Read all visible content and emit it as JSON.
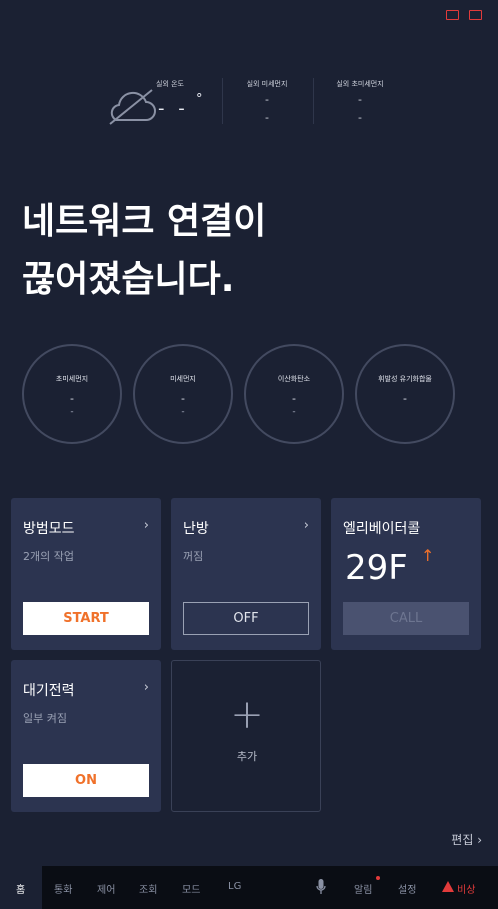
{
  "top": {
    "icons": [
      "screen-icon",
      "monitor-icon"
    ]
  },
  "weather": {
    "temp_label": "실외 온도",
    "temp_value": "- -",
    "temp_unit": "°",
    "dust_label": "실외 미세먼지",
    "dust_value1": "-",
    "dust_value2": "-",
    "fine_label": "실외 초미세먼지",
    "fine_value1": "-",
    "fine_value2": "-"
  },
  "headline": "네트워크 연결이\n끊어졌습니다.",
  "circles": [
    {
      "label": "초미세먼지",
      "v1": "-",
      "v2": "-"
    },
    {
      "label": "미세먼지",
      "v1": "-",
      "v2": "-"
    },
    {
      "label": "이산화탄소",
      "v1": "-",
      "v2": "-"
    },
    {
      "label": "휘발성 유기화합물",
      "v1": "-",
      "v2": ""
    }
  ],
  "cards": {
    "security": {
      "title": "방범모드",
      "chevron": "›",
      "sub": "2개의 작업",
      "button": "START"
    },
    "heating": {
      "title": "난방",
      "chevron": "›",
      "sub": "꺼짐",
      "button": "OFF"
    },
    "elevator": {
      "title": "엘리베이터콜",
      "floor": "29F",
      "arrow": "↑",
      "button": "CALL",
      "accent": "#f0712a"
    },
    "standby": {
      "title": "대기전력",
      "chevron": "›",
      "sub": "일부 켜짐",
      "button": "ON"
    },
    "add": {
      "label": "추가",
      "plus": "+"
    }
  },
  "edit": "편집 ›",
  "nav": {
    "home": "홈",
    "call": "통화",
    "control": "제어",
    "view": "조회",
    "mode": "모드",
    "lg": "LG",
    "mic": "mic-icon",
    "notice": "알림",
    "settings": "설정",
    "emergency": "비상",
    "emergency_color": "#e23b3b"
  }
}
